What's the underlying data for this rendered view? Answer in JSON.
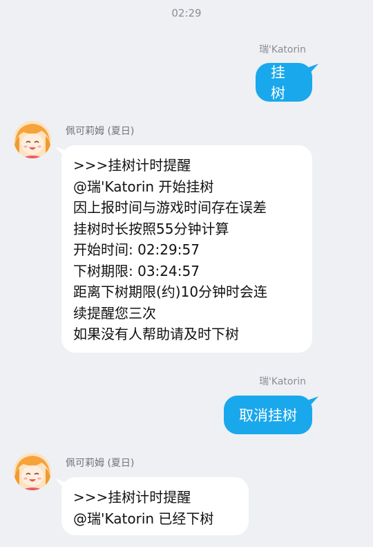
{
  "timestamp": "02:29",
  "messages": [
    {
      "sender": "瑞'Katorin",
      "text": "挂树"
    },
    {
      "sender": "佩可莉姆 (夏日)",
      "lines": [
        ">>>挂树计时提醒",
        "@瑞'Katorin  开始挂树",
        "因上报时间与游戏时间存在误差",
        "挂树时长按照55分钟计算",
        "开始时间: 02:29:57",
        "下树期限: 03:24:57",
        "距离下树期限(约)10分钟时会连",
        "续提醒您三次",
        "如果没有人帮助请及时下树"
      ]
    },
    {
      "sender": "瑞'Katorin",
      "text": "取消挂树"
    },
    {
      "sender": "佩可莉姆 (夏日)",
      "lines": [
        ">>>挂树计时提醒",
        "@瑞'Katorin  已经下树"
      ]
    }
  ],
  "colors": {
    "background": "#eef0f4",
    "sent_bubble": "#1aa8ec",
    "received_bubble": "#ffffff"
  },
  "icons": {
    "avatar": "anime-girl-avatar"
  }
}
